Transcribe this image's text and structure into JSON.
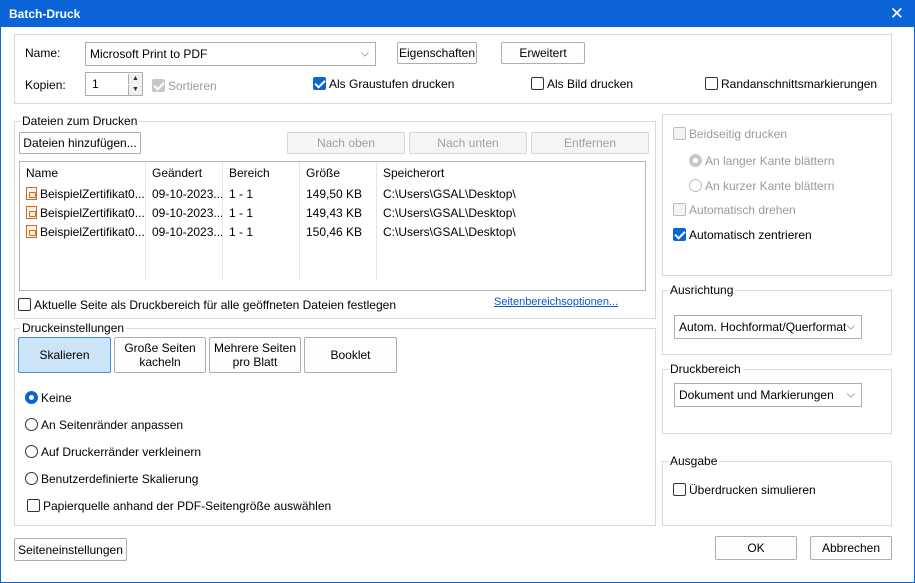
{
  "window": {
    "title": "Batch-Druck",
    "close_icon": "close-icon"
  },
  "printer": {
    "name_label": "Name:",
    "name_value": "Microsoft Print to PDF",
    "properties_button": "Eigenschaften",
    "advanced_button": "Erweitert",
    "copies_label": "Kopien:",
    "copies_value": "1",
    "collate_label": "Sortieren",
    "grayscale_label": "Als Graustufen drucken",
    "as_image_label": "Als Bild drucken",
    "bleed_marks_label": "Randanschnittsmarkierungen"
  },
  "files": {
    "legend": "Dateien zum Drucken",
    "add_button": "Dateien hinzufügen...",
    "up_button": "Nach oben",
    "down_button": "Nach unten",
    "remove_button": "Entfernen",
    "columns": [
      "Name",
      "Geändert",
      "Bereich",
      "Größe",
      "Speicherort"
    ],
    "rows": [
      {
        "name": "BeispielZertifikat0...",
        "modified": "09-10-2023...",
        "range": "1 - 1",
        "size": "149,50 KB",
        "location": "C:\\Users\\GSAL\\Desktop\\"
      },
      {
        "name": "BeispielZertifikat0...",
        "modified": "09-10-2023...",
        "range": "1 - 1",
        "size": "149,43 KB",
        "location": "C:\\Users\\GSAL\\Desktop\\"
      },
      {
        "name": "BeispielZertifikat0...",
        "modified": "09-10-2023...",
        "range": "1 - 1",
        "size": "150,46 KB",
        "location": "C:\\Users\\GSAL\\Desktop\\"
      }
    ],
    "current_page_label": "Aktuelle Seite als Druckbereich für alle geöffneten Dateien festlegen",
    "range_options_link": "Seitenbereichsoptionen..."
  },
  "print_settings": {
    "legend": "Druckeinstellungen",
    "tab_scale": "Skalieren",
    "tab_tile_line1": "Große Seiten",
    "tab_tile_line2": "kacheln",
    "tab_multiple_line1": "Mehrere Seiten",
    "tab_multiple_line2": "pro Blatt",
    "tab_booklet": "Booklet",
    "opt_none": "Keine",
    "opt_fit_margins": "An Seitenränder anpassen",
    "opt_shrink": "Auf Druckerränder verkleinern",
    "opt_custom": "Benutzerdefinierte Skalierung",
    "paper_source_label": "Papierquelle anhand der PDF-Seitengröße auswählen"
  },
  "duplex": {
    "both_sides_label": "Beidseitig drucken",
    "long_edge_label": "An langer Kante blättern",
    "short_edge_label": "An kurzer Kante blättern",
    "auto_rotate_label": "Automatisch drehen",
    "auto_center_label": "Automatisch zentrieren"
  },
  "orientation": {
    "legend": "Ausrichtung",
    "value": "Autom. Hochformat/Querformat"
  },
  "print_area": {
    "legend": "Druckbereich",
    "value": "Dokument und Markierungen"
  },
  "output": {
    "legend": "Ausgabe",
    "overprint_label": "Überdrucken simulieren"
  },
  "footer": {
    "page_setup_button": "Seiteneinstellungen",
    "ok_button": "OK",
    "cancel_button": "Abbrechen"
  },
  "colors": {
    "accent": "#0a64d8",
    "link": "#0a58ca"
  }
}
